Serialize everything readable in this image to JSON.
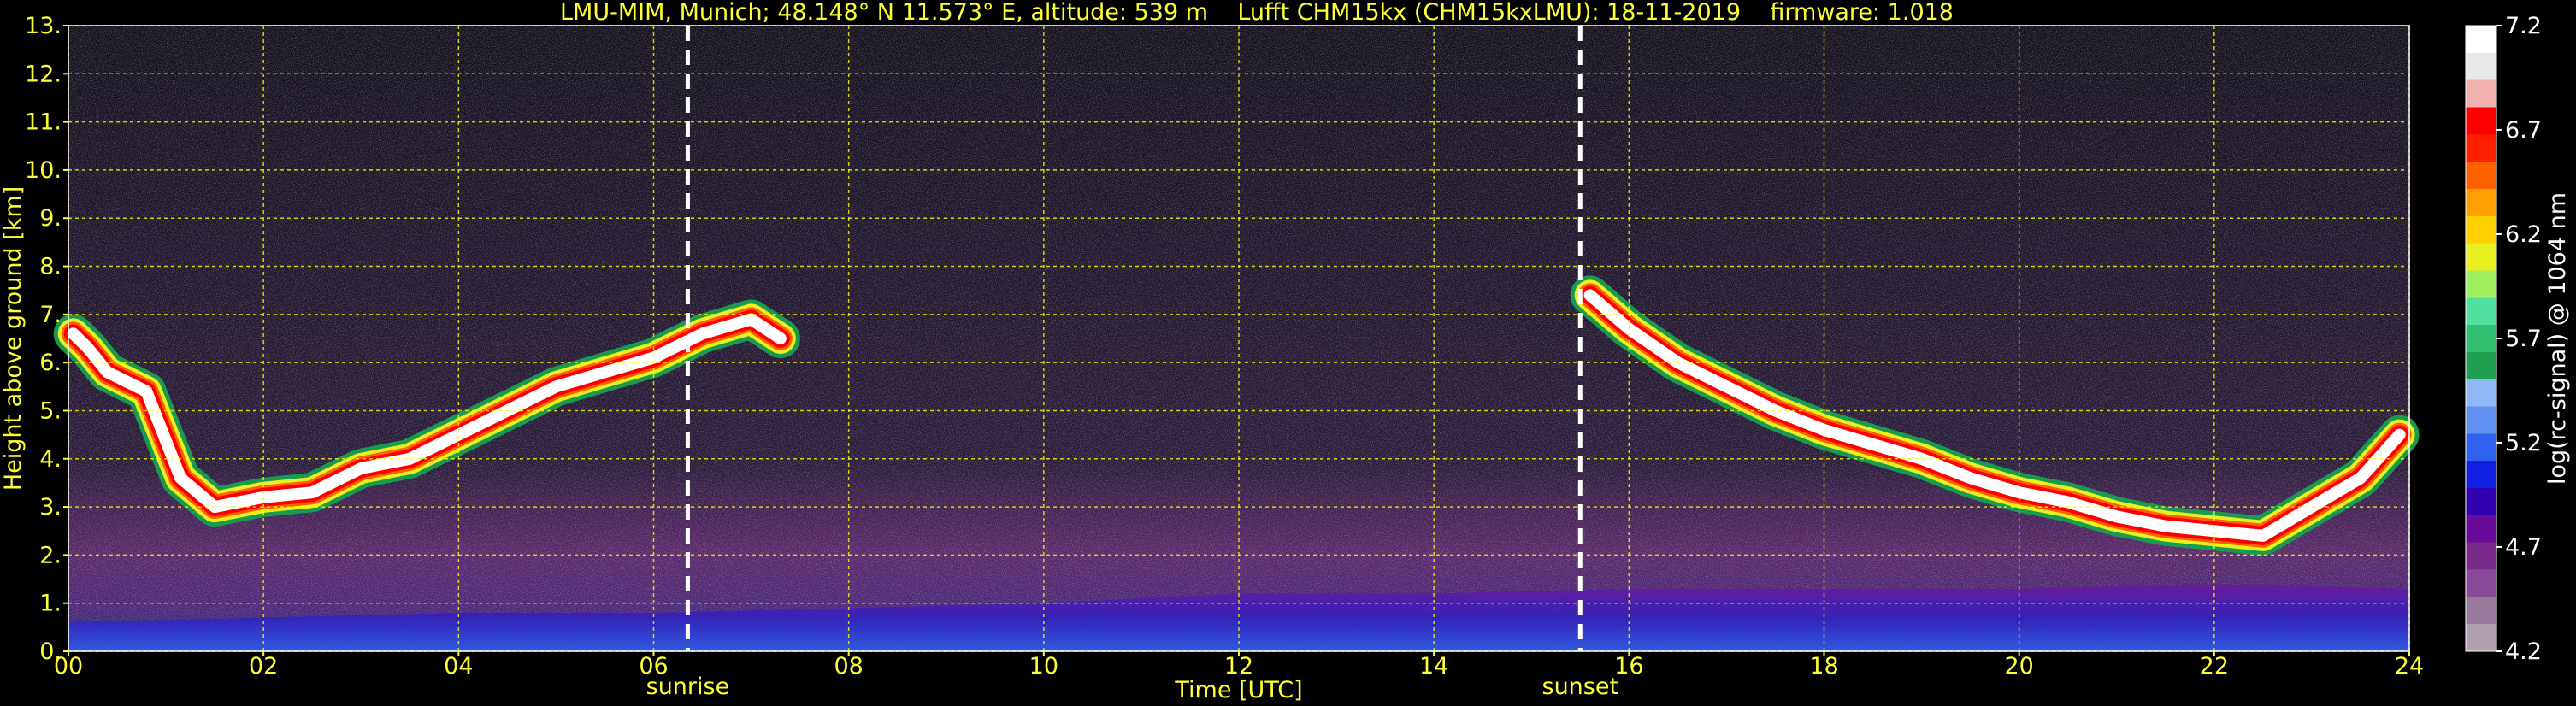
{
  "title": "LMU-MIM, Munich; 48.148° N 11.573° E, altitude: 539 m    Lufft CHM15kx (CHM15kxLMU): 18-11-2019    firmware: 1.018",
  "chart_data": {
    "type": "heatmap",
    "title": "LMU-MIM, Munich; 48.148° N 11.573° E, altitude: 539 m    Lufft CHM15kx (CHM15kxLMU): 18-11-2019    firmware: 1.018",
    "xlabel": "Time [UTC]",
    "ylabel": "Height above ground [km]",
    "xlim": [
      0,
      24
    ],
    "ylim": [
      0,
      13
    ],
    "x_ticks": [
      0,
      2,
      4,
      6,
      8,
      10,
      12,
      14,
      16,
      18,
      20,
      22,
      24
    ],
    "x_tick_labels": [
      "00",
      "02",
      "04",
      "06",
      "08",
      "10",
      "12",
      "14",
      "16",
      "18",
      "20",
      "22",
      "24"
    ],
    "y_ticks": [
      0,
      1,
      2,
      3,
      4,
      5,
      6,
      7,
      8,
      9,
      10,
      11,
      12,
      13
    ],
    "y_tick_labels": [
      "0.",
      "1.",
      "2.",
      "3.",
      "4.",
      "5.",
      "6.",
      "7.",
      "8.",
      "9.",
      "10.",
      "11.",
      "12.",
      "13."
    ],
    "grid": true,
    "grid_color": "#ffff00",
    "markers": [
      {
        "label": "sunrise",
        "x": 6.35
      },
      {
        "label": "sunset",
        "x": 15.5
      }
    ],
    "colorbar": {
      "label": "log(rc-signal) @ 1064 nm",
      "range": [
        4.2,
        7.2
      ],
      "ticks": [
        "4.2",
        "4.7",
        "5.2",
        "5.7",
        "6.2",
        "6.7",
        "7.2"
      ],
      "colors": [
        "#b0a0b0",
        "#9a7a9a",
        "#8a4a9a",
        "#7a2a8a",
        "#6a0a9a",
        "#3000b0",
        "#1020e0",
        "#3060f0",
        "#6090f0",
        "#90b8f8",
        "#20a050",
        "#30c070",
        "#50e0a0",
        "#a0f060",
        "#e8f020",
        "#ffd000",
        "#ffa000",
        "#ff6000",
        "#ff2000",
        "#ff0000",
        "#f0b0b0",
        "#e8e8e8",
        "#ffffff"
      ]
    },
    "layers": [
      {
        "name": "cloud",
        "points": [
          [
            0.05,
            6.6
          ],
          [
            0.2,
            6.3
          ],
          [
            0.4,
            5.8
          ],
          [
            0.8,
            5.4
          ],
          [
            1.15,
            3.6
          ],
          [
            1.5,
            3.0
          ],
          [
            2.0,
            3.2
          ],
          [
            2.5,
            3.3
          ],
          [
            3.0,
            3.8
          ],
          [
            3.5,
            4.0
          ],
          [
            4.0,
            4.5
          ],
          [
            4.5,
            5.0
          ],
          [
            5.0,
            5.5
          ],
          [
            5.5,
            5.8
          ],
          [
            6.0,
            6.1
          ],
          [
            6.5,
            6.6
          ],
          [
            7.0,
            6.9
          ],
          [
            7.3,
            6.5
          ],
          [
            15.6,
            7.4
          ],
          [
            16.0,
            6.7
          ],
          [
            16.5,
            6.0
          ],
          [
            17.0,
            5.5
          ],
          [
            17.5,
            5.0
          ],
          [
            18.0,
            4.6
          ],
          [
            18.5,
            4.3
          ],
          [
            19.0,
            4.0
          ],
          [
            19.5,
            3.6
          ],
          [
            20.0,
            3.3
          ],
          [
            20.5,
            3.1
          ],
          [
            21.0,
            2.8
          ],
          [
            21.5,
            2.6
          ],
          [
            22.0,
            2.5
          ],
          [
            22.5,
            2.4
          ],
          [
            23.0,
            3.0
          ],
          [
            23.5,
            3.6
          ],
          [
            23.9,
            4.5
          ]
        ]
      },
      {
        "name": "boundary-layer",
        "points": [
          [
            0,
            0.6
          ],
          [
            2,
            0.7
          ],
          [
            4,
            0.8
          ],
          [
            6,
            0.8
          ],
          [
            8,
            0.9
          ],
          [
            10,
            1.0
          ],
          [
            12,
            1.2
          ],
          [
            14,
            1.2
          ],
          [
            16,
            1.3
          ],
          [
            18,
            1.3
          ],
          [
            20,
            1.3
          ],
          [
            22,
            1.4
          ],
          [
            24,
            1.3
          ]
        ]
      }
    ]
  }
}
